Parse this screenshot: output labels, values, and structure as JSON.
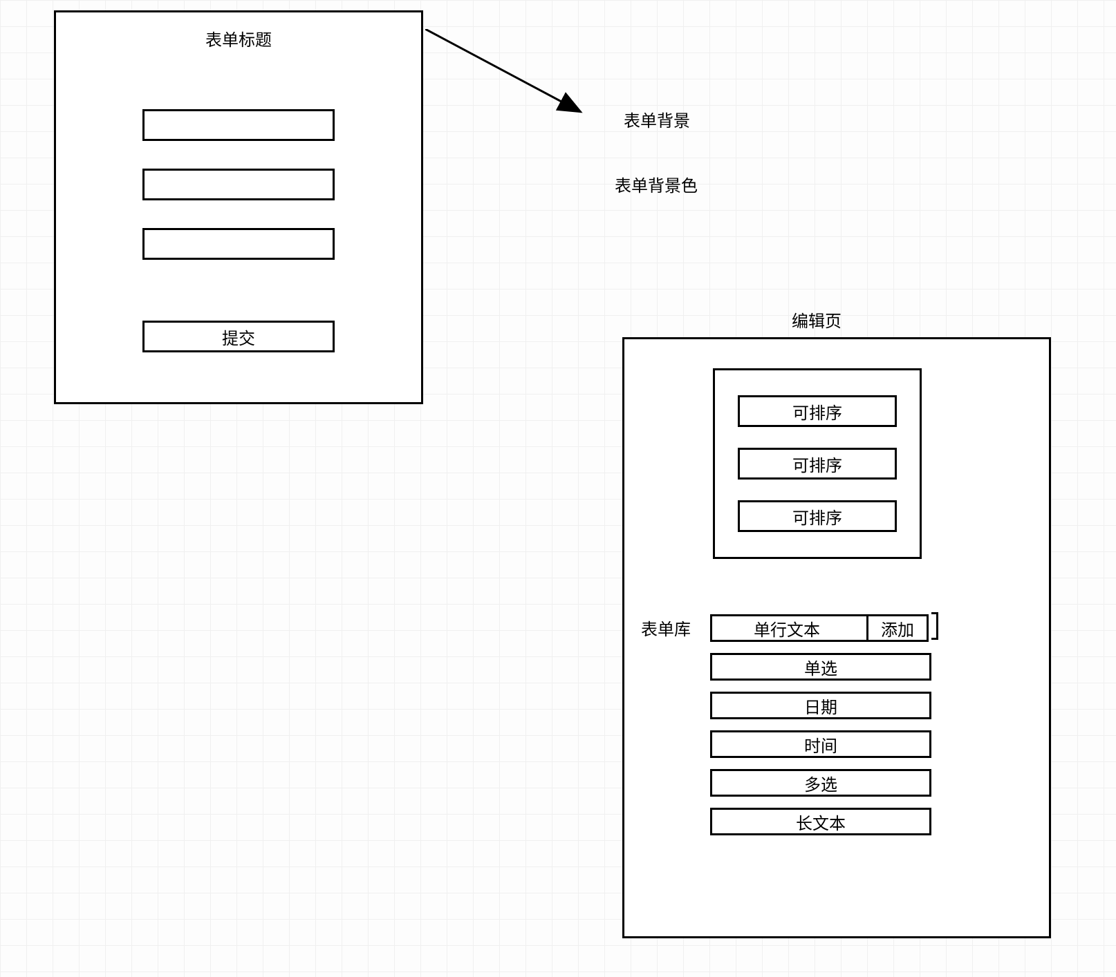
{
  "form_panel": {
    "title": "表单标题",
    "submit_label": "提交"
  },
  "labels": {
    "form_bg": "表单背景",
    "form_bg_color": "表单背景色"
  },
  "editor": {
    "title": "编辑页",
    "sortable_items": [
      "可排序",
      "可排序",
      "可排序"
    ],
    "library_label": "表单库",
    "library_items": [
      {
        "label": "单行文本",
        "add_label": "添加"
      },
      {
        "label": "单选"
      },
      {
        "label": "日期"
      },
      {
        "label": "时间"
      },
      {
        "label": "多选"
      },
      {
        "label": "长文本"
      }
    ]
  }
}
